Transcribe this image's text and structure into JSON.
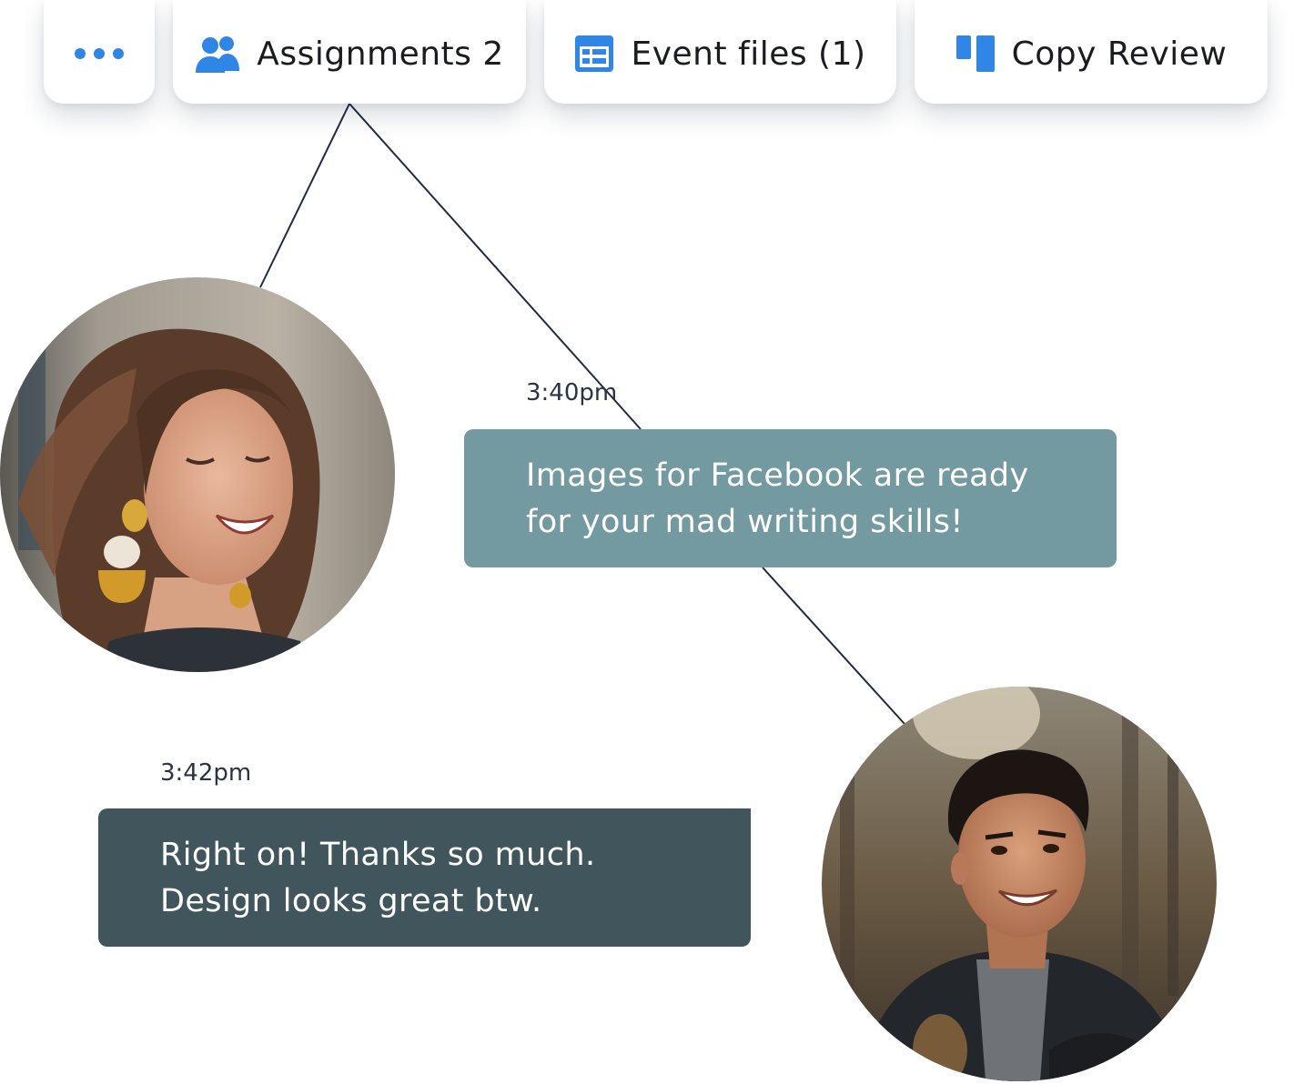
{
  "toolbar": {
    "more_icon": "more-dots-icon",
    "tabs": [
      {
        "label": "Assignments 2",
        "icon": "people-icon"
      },
      {
        "label": "Event files (1)",
        "icon": "calendar-grid-icon"
      },
      {
        "label": "Copy Review",
        "icon": "review-columns-icon"
      }
    ]
  },
  "messages": [
    {
      "time": "3:40pm",
      "text": "Images for Facebook are ready for your mad writing skills!",
      "color": "#739aa1"
    },
    {
      "time": "3:42pm",
      "text": "Right on! Thanks so much. Design looks great btw.",
      "color": "#40565c"
    }
  ],
  "colors": {
    "accent": "#2f86e6",
    "connector": "#1f2b45",
    "text": "#1a1c22"
  }
}
